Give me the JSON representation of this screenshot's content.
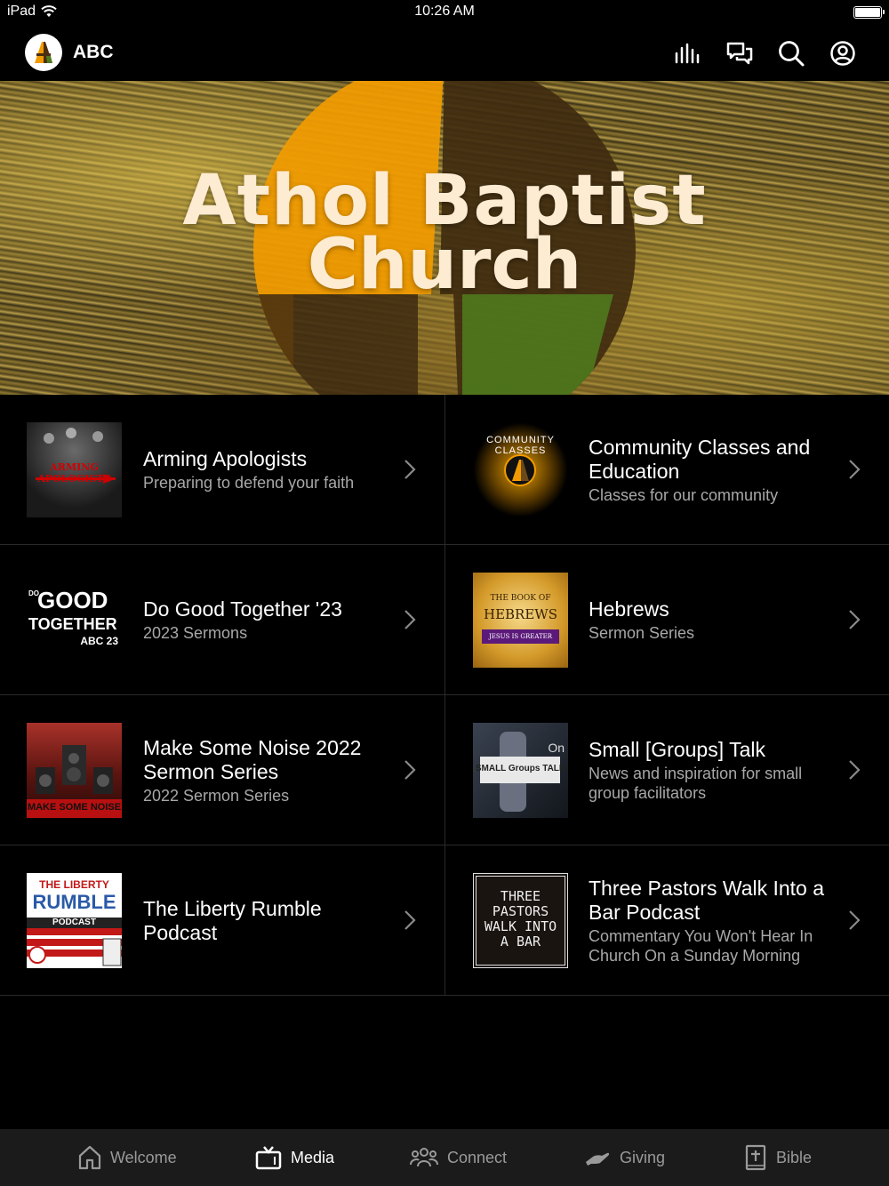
{
  "status_bar": {
    "device": "iPad",
    "time": "10:26 AM"
  },
  "header": {
    "app_title": "ABC",
    "icons": [
      "audio-bars-icon",
      "chat-icon",
      "search-icon",
      "account-icon"
    ]
  },
  "hero": {
    "line1": "Athol Baptist",
    "line2": "Church"
  },
  "media_items": [
    {
      "title": "Arming Apologists",
      "subtitle": "Preparing to defend your faith",
      "thumb_text": "ARMING APOLOGISTS"
    },
    {
      "title": "Community Classes and Education",
      "subtitle": "Classes for our community",
      "thumb_text": "COMMUNITY CLASSES"
    },
    {
      "title": "Do Good Together '23",
      "subtitle": "2023 Sermons",
      "thumb_line1": "GOOD",
      "thumb_line2": "TOGETHER",
      "thumb_line3": "ABC 23",
      "thumb_do": "DO"
    },
    {
      "title": "Hebrews",
      "subtitle": "Sermon Series",
      "thumb_line1": "THE BOOK OF",
      "thumb_line2": "HEBREWS",
      "thumb_line3": "JESUS IS GREATER"
    },
    {
      "title": "Make Some Noise 2022 Sermon Series",
      "subtitle": "2022 Sermon Series",
      "thumb_text": "MAKE SOME NOISE"
    },
    {
      "title": "Small [Groups] Talk",
      "subtitle": "News and inspiration for small group facilitators",
      "thumb_text": "SMALL Groups TALK",
      "thumb_on": "On"
    },
    {
      "title": "The Liberty Rumble Podcast",
      "subtitle": "",
      "thumb_line1": "THE LIBERTY",
      "thumb_line2": "RUMBLE",
      "thumb_line3": "PODCAST"
    },
    {
      "title": "Three Pastors Walk Into a Bar Podcast",
      "subtitle": "Commentary You Won't Hear In Church On a Sunday Morning",
      "thumb_line1": "THREE",
      "thumb_line2": "PASTORS",
      "thumb_line3": "WALK INTO",
      "thumb_line4": "A BAR"
    }
  ],
  "tabs": [
    {
      "label": "Welcome",
      "icon": "home-icon",
      "active": false
    },
    {
      "label": "Media",
      "icon": "tv-icon",
      "active": true
    },
    {
      "label": "Connect",
      "icon": "people-icon",
      "active": false
    },
    {
      "label": "Giving",
      "icon": "hand-icon",
      "active": false
    },
    {
      "label": "Bible",
      "icon": "bible-icon",
      "active": false
    }
  ],
  "colors": {
    "brand_orange": "#f29b00",
    "brand_brown": "#4a2e12",
    "brand_green": "#4f7a1e",
    "tabbar_bg": "#1b1b1b"
  }
}
